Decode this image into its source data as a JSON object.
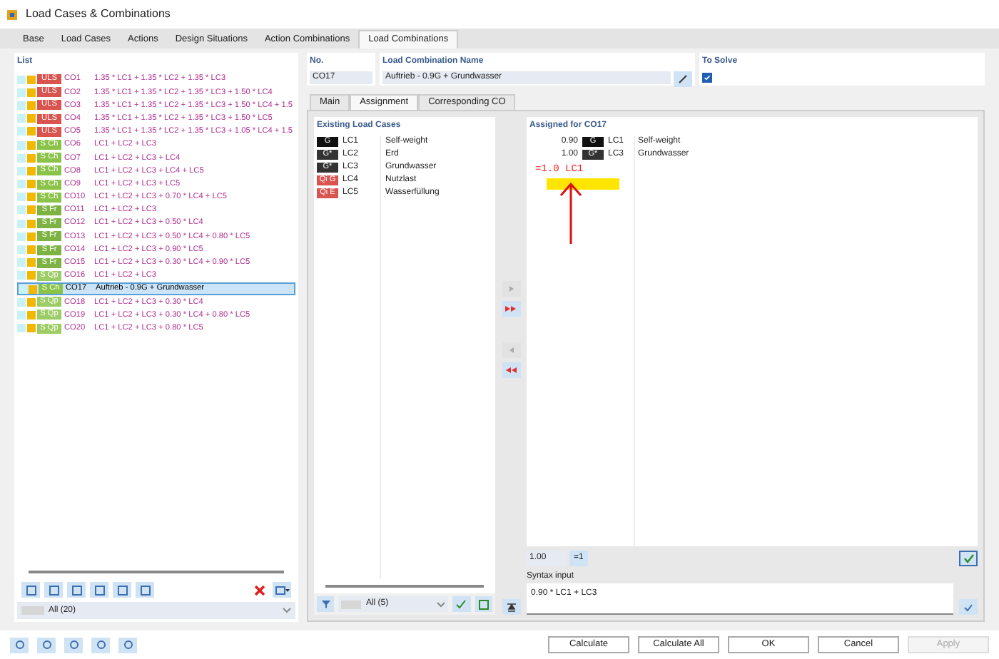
{
  "window": {
    "title": "Load Cases & Combinations"
  },
  "tabs": [
    {
      "label": "Base",
      "selected": false
    },
    {
      "label": "Load Cases",
      "selected": false
    },
    {
      "label": "Actions",
      "selected": false
    },
    {
      "label": "Design Situations",
      "selected": false
    },
    {
      "label": "Action Combinations",
      "selected": false
    },
    {
      "label": "Load Combinations",
      "selected": true
    }
  ],
  "list": {
    "title": "List",
    "filter": "All (20)",
    "rows": [
      {
        "badge": "ULS",
        "color": "#d9534f",
        "no": "CO1",
        "text": "1.35 * LC1 + 1.35 * LC2 + 1.35 * LC3",
        "selected": false
      },
      {
        "badge": "ULS",
        "color": "#d9534f",
        "no": "CO2",
        "text": "1.35 * LC1 + 1.35 * LC2 + 1.35 * LC3 + 1.50 * LC4",
        "selected": false
      },
      {
        "badge": "ULS",
        "color": "#d9534f",
        "no": "CO3",
        "text": "1.35 * LC1 + 1.35 * LC2 + 1.35 * LC3 + 1.50 * LC4 + 1.5",
        "selected": false
      },
      {
        "badge": "ULS",
        "color": "#d9534f",
        "no": "CO4",
        "text": "1.35 * LC1 + 1.35 * LC2 + 1.35 * LC3 + 1.50 * LC5",
        "selected": false
      },
      {
        "badge": "ULS",
        "color": "#d9534f",
        "no": "CO5",
        "text": "1.35 * LC1 + 1.35 * LC2 + 1.35 * LC3 + 1.05 * LC4 + 1.5",
        "selected": false
      },
      {
        "badge": "S Ch",
        "color": "#8bc34a",
        "no": "CO6",
        "text": "LC1 + LC2 + LC3",
        "selected": false
      },
      {
        "badge": "S Ch",
        "color": "#8bc34a",
        "no": "CO7",
        "text": "LC1 + LC2 + LC3 + LC4",
        "selected": false
      },
      {
        "badge": "S Ch",
        "color": "#8bc34a",
        "no": "CO8",
        "text": "LC1 + LC2 + LC3 + LC4 + LC5",
        "selected": false
      },
      {
        "badge": "S Ch",
        "color": "#8bc34a",
        "no": "CO9",
        "text": "LC1 + LC2 + LC3 + LC5",
        "selected": false
      },
      {
        "badge": "S Ch",
        "color": "#8bc34a",
        "no": "CO10",
        "text": "LC1 + LC2 + LC3 + 0.70 * LC4 + LC5",
        "selected": false
      },
      {
        "badge": "S Fr",
        "color": "#7cb342",
        "no": "CO11",
        "text": "LC1 + LC2 + LC3",
        "selected": false
      },
      {
        "badge": "S Fr",
        "color": "#7cb342",
        "no": "CO12",
        "text": "LC1 + LC2 + LC3 + 0.50 * LC4",
        "selected": false
      },
      {
        "badge": "S Fr",
        "color": "#7cb342",
        "no": "CO13",
        "text": "LC1 + LC2 + LC3 + 0.50 * LC4 + 0.80 * LC5",
        "selected": false
      },
      {
        "badge": "S Fr",
        "color": "#7cb342",
        "no": "CO14",
        "text": "LC1 + LC2 + LC3 + 0.90 * LC5",
        "selected": false
      },
      {
        "badge": "S Fr",
        "color": "#7cb342",
        "no": "CO15",
        "text": "LC1 + LC2 + LC3 + 0.30 * LC4 + 0.90 * LC5",
        "selected": false
      },
      {
        "badge": "S Qp",
        "color": "#9ccc65",
        "no": "CO16",
        "text": "LC1 + LC2 + LC3",
        "selected": false
      },
      {
        "badge": "S Ch",
        "color": "#8bc34a",
        "no": "CO17",
        "text": "Auftrieb - 0.9G + Grundwasser",
        "selected": true
      },
      {
        "badge": "S Qp",
        "color": "#9ccc65",
        "no": "CO18",
        "text": "LC1 + LC2 + LC3 + 0.30 * LC4",
        "selected": false
      },
      {
        "badge": "S Qp",
        "color": "#9ccc65",
        "no": "CO19",
        "text": "LC1 + LC2 + LC3 + 0.30 * LC4 + 0.80 * LC5",
        "selected": false
      },
      {
        "badge": "S Qp",
        "color": "#9ccc65",
        "no": "CO20",
        "text": "LC1 + LC2 + LC3 + 0.80 * LC5",
        "selected": false
      }
    ]
  },
  "header": {
    "no_label": "No.",
    "no": "CO17",
    "name_label": "Load Combination Name",
    "name": "Auftrieb - 0.9G + Grundwasser",
    "solve_label": "To Solve",
    "to_solve": true
  },
  "subtabs": [
    {
      "label": "Main",
      "selected": false
    },
    {
      "label": "Assignment",
      "selected": true
    },
    {
      "label": "Corresponding CO",
      "selected": false
    }
  ],
  "existing": {
    "title": "Existing Load Cases",
    "filter": "All (5)",
    "cases": [
      {
        "badge": "G",
        "color": "#111111",
        "lc": "LC1",
        "name": "Self-weight"
      },
      {
        "badge": "G*",
        "color": "#333333",
        "lc": "LC2",
        "name": "Erd"
      },
      {
        "badge": "G*",
        "color": "#333333",
        "lc": "LC3",
        "name": "Grundwasser"
      },
      {
        "badge": "Qi G",
        "color": "#d9534f",
        "lc": "LC4",
        "name": "Nutzlast"
      },
      {
        "badge": "Qi E",
        "color": "#d9534f",
        "lc": "LC5",
        "name": "Wasserfüllung"
      }
    ]
  },
  "assigned": {
    "title": "Assigned for CO17",
    "cases": [
      {
        "factor": "0.90",
        "badge": "G",
        "color": "#111111",
        "lc": "LC1",
        "name": "Self-weight"
      },
      {
        "factor": "1.00",
        "badge": "G*",
        "color": "#333333",
        "lc": "LC3",
        "name": "Grundwasser"
      }
    ],
    "annotation": "=1.0 LC1",
    "factor_value": "1.00",
    "set_one": "=1",
    "syntax_label": "Syntax input",
    "syntax": "0.90 * LC1 + LC3"
  },
  "buttons": [
    {
      "label": "Calculate",
      "disabled": false
    },
    {
      "label": "Calculate All",
      "disabled": false
    },
    {
      "label": "OK",
      "disabled": false
    },
    {
      "label": "Cancel",
      "disabled": false
    },
    {
      "label": "Apply",
      "disabled": true
    }
  ]
}
